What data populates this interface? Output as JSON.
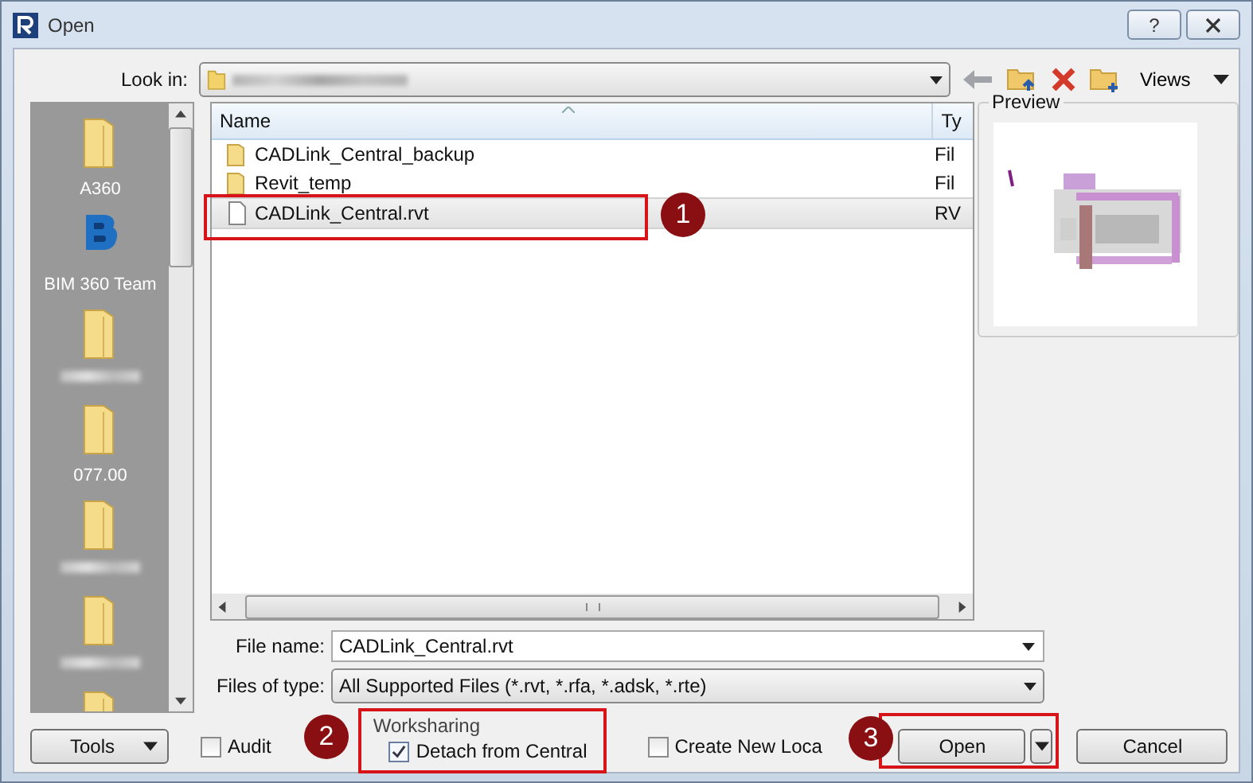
{
  "window": {
    "title": "Open",
    "help_button": "?"
  },
  "look_in": {
    "label": "Look in:"
  },
  "toolbar": {
    "views": "Views"
  },
  "places": [
    {
      "kind": "folder",
      "label": "A360"
    },
    {
      "kind": "bim",
      "label": "BIM 360 Team"
    },
    {
      "kind": "folder",
      "redacted": true
    },
    {
      "kind": "folder",
      "label": "077.00"
    },
    {
      "kind": "folder",
      "redacted": true
    },
    {
      "kind": "folder",
      "redacted": true
    },
    {
      "kind": "folder"
    }
  ],
  "columns": [
    "Name",
    "Ty"
  ],
  "files": [
    {
      "kind": "folder",
      "name": "CADLink_Central_backup",
      "type": "Fil",
      "selected": false
    },
    {
      "kind": "folder",
      "name": "Revit_temp",
      "type": "Fil",
      "selected": false
    },
    {
      "kind": "file",
      "name": "CADLink_Central.rvt",
      "type": "RV",
      "selected": true
    }
  ],
  "preview": {
    "label": "Preview",
    "kind": "picture"
  },
  "file_name": {
    "label": "File name:",
    "value": "CADLink_Central.rvt"
  },
  "file_type": {
    "label": "Files of type:",
    "value": "All Supported Files  (*.rvt, *.rfa, *.adsk, *.rte)"
  },
  "tools": "Tools",
  "audit": {
    "label": "Audit",
    "checked": false
  },
  "worksharing": {
    "title": "Worksharing",
    "label": "Detach from Central",
    "checked": true
  },
  "create_new_local": {
    "label": "Create New Loca",
    "checked": false
  },
  "open": "Open",
  "cancel": "Cancel",
  "callouts": [
    {
      "number": "1"
    },
    {
      "number": "2"
    },
    {
      "number": "3"
    }
  ]
}
